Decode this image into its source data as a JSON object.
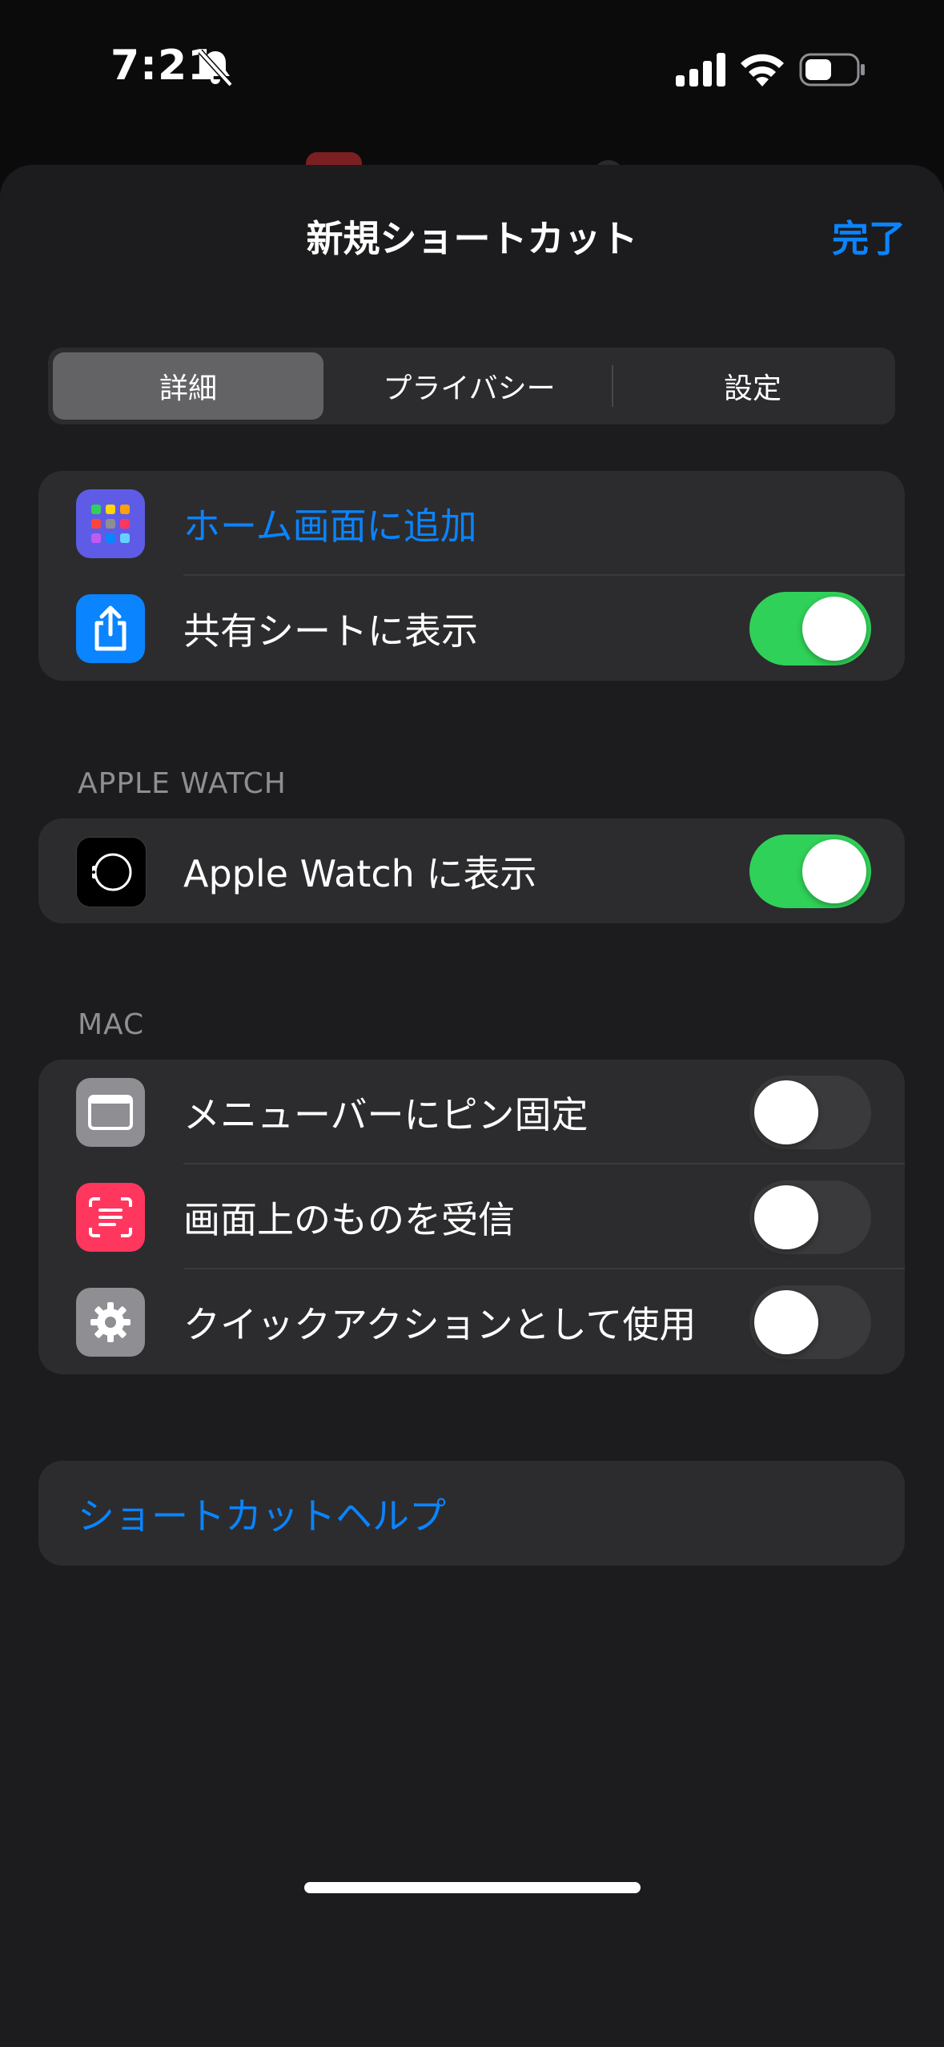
{
  "status_bar": {
    "time": "7:21",
    "icons": [
      "bell-slash-icon",
      "cellular-signal-icon",
      "wifi-icon",
      "battery-icon"
    ]
  },
  "sheet": {
    "title": "新規ショートカット",
    "done_label": "完了"
  },
  "segments": [
    {
      "label": "詳細",
      "selected": true
    },
    {
      "label": "プライバシー",
      "selected": false
    },
    {
      "label": "設定",
      "selected": false
    }
  ],
  "group_general": [
    {
      "label": "ホーム画面に追加",
      "icon": "home-screen-grid-icon",
      "icon_color": "#5e5ce6",
      "link": true
    },
    {
      "label": "共有シートに表示",
      "icon": "share-icon",
      "icon_color": "#0a84ff",
      "toggle": true
    }
  ],
  "apple_watch": {
    "header": "APPLE WATCH",
    "rows": [
      {
        "label": "Apple Watch に表示",
        "icon": "apple-watch-icon",
        "icon_color": "#000000",
        "toggle": true
      }
    ]
  },
  "mac": {
    "header": "MAC",
    "rows": [
      {
        "label": "メニューバーにピン固定",
        "icon": "menubar-window-icon",
        "icon_color": "#8e8e93",
        "toggle": false
      },
      {
        "label": "画面上のものを受信",
        "icon": "screen-scan-icon",
        "icon_color": "#ff375f",
        "toggle": false
      },
      {
        "label": "クイックアクションとして使用",
        "icon": "gear-icon",
        "icon_color": "#8e8e93",
        "toggle": false
      }
    ]
  },
  "help_link": "ショートカットヘルプ",
  "colors": {
    "accent": "#0a84ff",
    "toggle_on": "#30d158",
    "sheet_bg": "#1c1c1e",
    "group_bg": "#2c2c2e"
  }
}
